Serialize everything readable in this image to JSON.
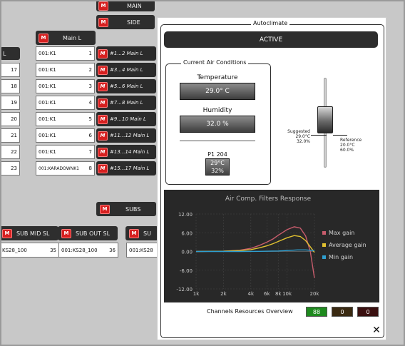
{
  "buses": {
    "main_label": "MAIN",
    "side_label": "SIDE",
    "subs_label": "SUBS",
    "mute_glyph": "M"
  },
  "main_l": {
    "header": "Main L",
    "left_partial_header": "L",
    "left_indices": [
      "17",
      "18",
      "19",
      "20",
      "21",
      "22",
      "23"
    ],
    "rows": [
      {
        "name": "001:K1",
        "index": "1",
        "selector": "#1...2 Main L"
      },
      {
        "name": "001:K1",
        "index": "2",
        "selector": "#3...4 Main L"
      },
      {
        "name": "001:K1",
        "index": "3",
        "selector": "#5...6 Main L"
      },
      {
        "name": "001:K1",
        "index": "4",
        "selector": "#7...8 Main L"
      },
      {
        "name": "001:K1",
        "index": "5",
        "selector": "#9...10 Main L"
      },
      {
        "name": "001:K1",
        "index": "6",
        "selector": "#11...12 Main L"
      },
      {
        "name": "001:K1",
        "index": "7",
        "selector": "#13...14 Main L"
      },
      {
        "name": "001:KARADOWNK1",
        "index": "8",
        "selector": "#15...17 Main L"
      }
    ]
  },
  "sub_groups": [
    {
      "header": "SUB MID SL",
      "name": "KS28_100",
      "index": "35"
    },
    {
      "header": "SUB OUT SL",
      "name": "001:KS28_100",
      "index": "36"
    },
    {
      "header": "SU",
      "name": "001:KS28",
      "index": ""
    }
  ],
  "autoclimate": {
    "title": "Autoclimate",
    "status": "ACTIVE",
    "conditions_title": "Current Air Conditions",
    "temperature_label": "Temperature",
    "temperature_value": "29.0° C",
    "humidity_label": "Humidity",
    "humidity_value": "32.0 %",
    "probe_label": "P1 204",
    "probe_temp": "29°C",
    "probe_humidity": "32%",
    "slider_level": 0.55,
    "suggested": {
      "label": "Suggested",
      "temp": "29.0°C",
      "humidity": "32.0%"
    },
    "reference": {
      "label": "Reference",
      "temp": "20.0°C",
      "humidity": "60.0%"
    },
    "resources_label": "Channels Resources Overview",
    "resources": [
      {
        "value": "88",
        "bg": "#1e8a1e",
        "fg": "#ffffff"
      },
      {
        "value": "0",
        "bg": "#3a2a12",
        "fg": "#ffffff"
      },
      {
        "value": "0",
        "bg": "#3a1010",
        "fg": "#ffffff"
      }
    ],
    "close_glyph": "✕"
  },
  "chart_data": {
    "type": "line",
    "title": "Air Comp. Filters Response",
    "x_log": true,
    "x_ticks": [
      "1k",
      "2k",
      "4k",
      "6k",
      "8k",
      "10k",
      "20k"
    ],
    "x_tick_values": [
      1000,
      2000,
      4000,
      6000,
      8000,
      10000,
      20000
    ],
    "y_ticks": [
      "12.00",
      "6.00",
      "0.00",
      "-6.00",
      "-12.00"
    ],
    "y_tick_values": [
      12,
      6,
      0,
      -6,
      -12
    ],
    "xlim": [
      1000,
      20000
    ],
    "ylim": [
      -12,
      12
    ],
    "grid": true,
    "legend_position": "right",
    "series": [
      {
        "name": "Max gain",
        "color": "#c85c6c",
        "points": [
          [
            1000,
            0
          ],
          [
            2000,
            0.1
          ],
          [
            3000,
            0.4
          ],
          [
            4000,
            1
          ],
          [
            5000,
            2
          ],
          [
            6000,
            3
          ],
          [
            7000,
            4
          ],
          [
            8000,
            5.2
          ],
          [
            10000,
            7
          ],
          [
            12000,
            7.9
          ],
          [
            14000,
            7.5
          ],
          [
            16000,
            5
          ],
          [
            18000,
            0
          ],
          [
            20000,
            -8.5
          ]
        ]
      },
      {
        "name": "Average gain",
        "color": "#e0c030",
        "points": [
          [
            1000,
            0
          ],
          [
            2000,
            0.1
          ],
          [
            3000,
            0.3
          ],
          [
            4000,
            0.6
          ],
          [
            5000,
            1.2
          ],
          [
            6000,
            1.8
          ],
          [
            7000,
            2.5
          ],
          [
            8000,
            3.2
          ],
          [
            10000,
            4.4
          ],
          [
            12000,
            5.1
          ],
          [
            14000,
            4.8
          ],
          [
            16000,
            3.5
          ],
          [
            18000,
            1.5
          ],
          [
            20000,
            -0.3
          ]
        ]
      },
      {
        "name": "Min gain",
        "color": "#2f9fd0",
        "points": [
          [
            1000,
            0
          ],
          [
            3000,
            0
          ],
          [
            5000,
            0.05
          ],
          [
            8000,
            0.15
          ],
          [
            10000,
            0.3
          ],
          [
            13000,
            0.5
          ],
          [
            16000,
            0.5
          ],
          [
            18000,
            0.4
          ],
          [
            20000,
            0.3
          ]
        ]
      }
    ]
  }
}
